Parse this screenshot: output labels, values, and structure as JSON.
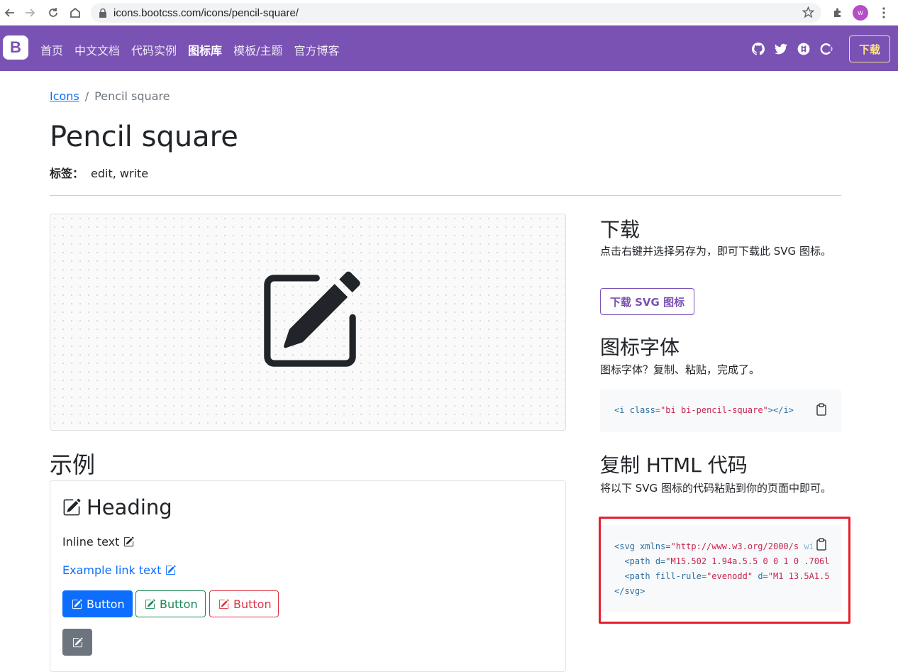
{
  "browser": {
    "url": "icons.bootcss.com/icons/pencil-square/",
    "avatar_letter": "w"
  },
  "navbar": {
    "brand": "B",
    "links": [
      "首页",
      "中文文档",
      "代码实例",
      "图标库",
      "模板/主题",
      "官方博客"
    ],
    "active_link": "图标库",
    "download_label": "下载",
    "colors": {
      "bg": "#7952b3",
      "accent": "#ffe484"
    }
  },
  "breadcrumb": {
    "root": "Icons",
    "current": "Pencil square"
  },
  "page": {
    "title": "Pencil square",
    "tags_label": "标签：",
    "tags_value": "edit, write"
  },
  "examples": {
    "title": "示例",
    "heading": "Heading",
    "inline_text": "Inline text",
    "link_text": "Example link text",
    "buttons": [
      "Button",
      "Button",
      "Button"
    ]
  },
  "sidebar": {
    "download_title": "下载",
    "download_desc": "点击右键并选择另存为，即可下载此 SVG 图标。",
    "download_svg_button": "下载 SVG 图标",
    "font_title": "图标字体",
    "font_desc": "图标字体？复制、粘贴，完成了。",
    "font_code": {
      "open_tag": "<i ",
      "attr": "class=",
      "value": "\"bi bi-pencil-square\"",
      "close": "></i>"
    },
    "html_title": "复制 HTML 代码",
    "html_desc": "将以下 SVG 图标的代码粘贴到你的页面中即可。",
    "html_code": {
      "line1_tag": "<svg ",
      "line1_attr": "xmlns=",
      "line1_val": "\"http://www.w3.org/2000/s",
      "line1_rest": " wi",
      "line2_tag": "<path ",
      "line2_attr": "d=",
      "line2_val": "\"M15.502 1.94a.5.5 0 0 1 0 .706l",
      "line3_tag": "<path ",
      "line3_attr": "fill-rule=",
      "line3_val": "\"evenodd\"",
      "line3_attr2": " d=",
      "line3_val2": "\"M1 13.5A1.5",
      "line4_tag": "</svg>"
    }
  }
}
